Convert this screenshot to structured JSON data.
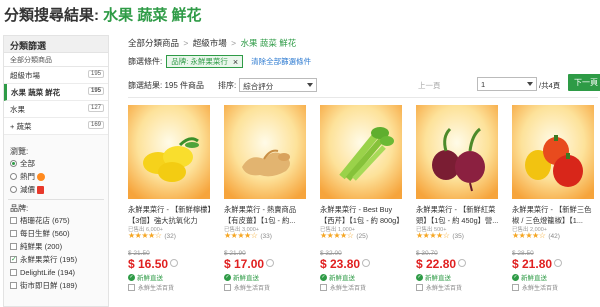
{
  "page": {
    "title_prefix": "分類搜尋結果:",
    "title_accent": "水果 蔬菜 鮮花"
  },
  "sidebar": {
    "header": "分類篩選",
    "all_link": "全部分類商品",
    "categories": [
      {
        "label": "超級市場",
        "count": "195"
      },
      {
        "label": "水果 蔬菜 鮮花",
        "count": "195"
      },
      {
        "label": "水果",
        "count": "127"
      },
      {
        "label": "+ 蔬菜",
        "count": "169"
      }
    ],
    "browse_label": "瀏覽:",
    "browse_options": [
      {
        "label": "全部",
        "selected": true
      },
      {
        "label": "熱門",
        "selected": false
      },
      {
        "label": "減價",
        "selected": false
      }
    ],
    "brand_label": "品牌:",
    "brands": [
      {
        "label": "梧珊花店 (675)",
        "checked": false
      },
      {
        "label": "每日生鮮 (560)",
        "checked": false
      },
      {
        "label": "純鮮果 (200)",
        "checked": false
      },
      {
        "label": "永鮮果菜行 (195)",
        "checked": true
      },
      {
        "label": "DelightLife (194)",
        "checked": false
      },
      {
        "label": "街市即日鮮 (189)",
        "checked": false
      }
    ]
  },
  "main": {
    "breadcrumb": [
      "全部分類商品",
      "超級市場",
      "水果 蔬菜 鮮花"
    ],
    "condition_label": "篩選條件:",
    "chip_label": "品牌: 永鮮果菜行",
    "chip_close": "×",
    "clear_link": "清除全部篩選條件",
    "results_text": "篩選結果: 195 件商品",
    "sort_label": "排序:",
    "sort_value": "綜合評分",
    "prev_label": "上一頁",
    "page_value": "1",
    "page_total": "/共4頁",
    "next_label": "下一頁"
  },
  "products": [
    {
      "name": "永鮮果菜行 - 【新鮮檸檬】【3個】強大抗氧化力",
      "sold": "已售出 6,000+",
      "stars": "★★★★☆",
      "reviews": "(32)",
      "old_price": "$ 21.50",
      "price": "$ 16.50",
      "fresh": "新鮮直送",
      "store": "永鮮生活百貨",
      "image": "lemon"
    },
    {
      "name": "永鮮果菜行 - 熱賣商品【有皮薑】【1包 - 約...",
      "sold": "已售出 3,000+",
      "stars": "★★★★☆",
      "reviews": "(33)",
      "old_price": "$ 21.90",
      "price": "$ 17.00",
      "fresh": "新鮮直送",
      "store": "永鮮生活百貨",
      "image": "ginger"
    },
    {
      "name": "永鮮果菜行 - Best Buy【西芹】【1包 - 約 800g】天...",
      "sold": "已售出 1,000+",
      "stars": "★★★★☆",
      "reviews": "(25)",
      "old_price": "$ 32.00",
      "price": "$ 23.80",
      "fresh": "新鮮直送",
      "store": "永鮮生活百貨",
      "image": "celery"
    },
    {
      "name": "永鮮果菜行 - 【新鮮紅菜頭】【1包 - 約 450g】營...",
      "sold": "已售出 500+",
      "stars": "★★★★☆",
      "reviews": "(35)",
      "old_price": "$ 30.70",
      "price": "$ 22.80",
      "fresh": "新鮮直送",
      "store": "永鮮生活百貨",
      "image": "beetroot"
    },
    {
      "name": "永鮮果菜行 - 【新鮮三色椒 / 三色燈籠椒】【1...",
      "sold": "已售出 2,000+",
      "stars": "★★★★☆",
      "reviews": "(42)",
      "old_price": "$ 28.50",
      "price": "$ 21.80",
      "fresh": "新鮮直送",
      "store": "永鮮生活百貨",
      "image": "peppers"
    }
  ],
  "colors": {
    "accent": "#2e9b46",
    "price": "#e02020",
    "link": "#2e7bd1"
  }
}
